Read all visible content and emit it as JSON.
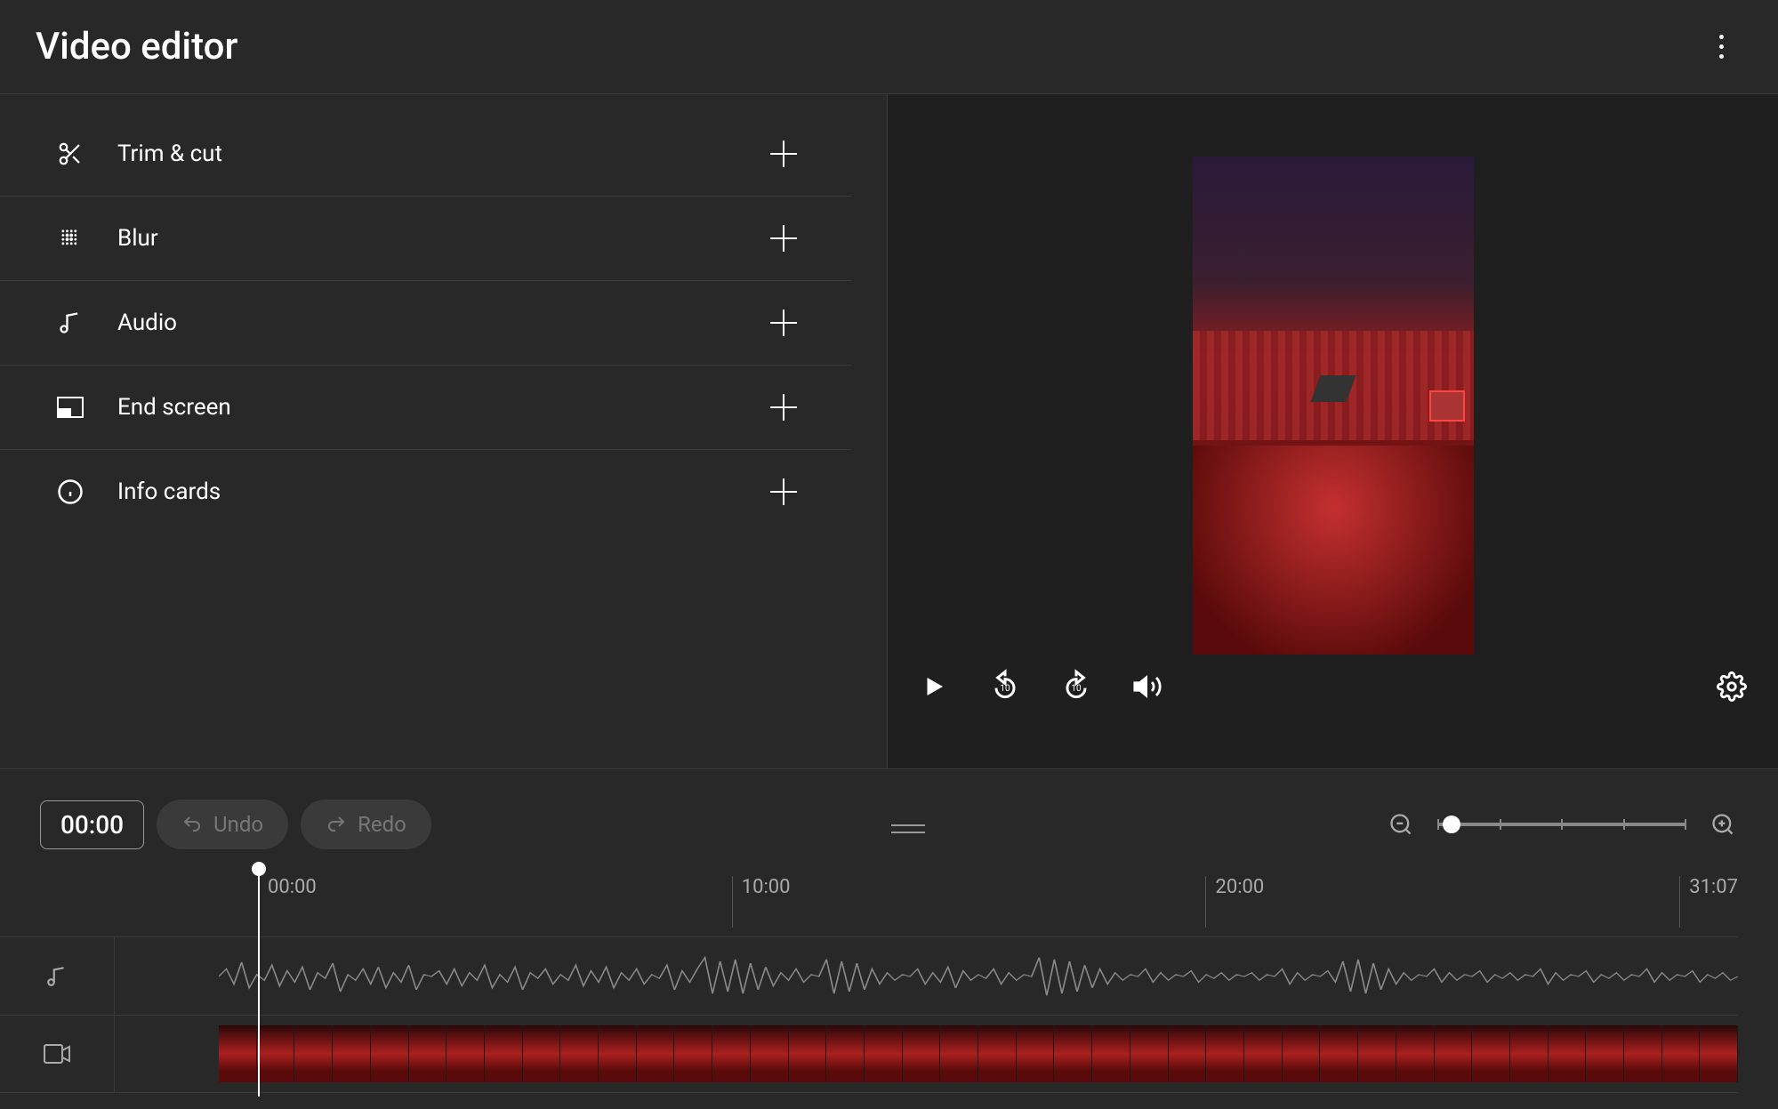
{
  "header": {
    "title": "Video editor"
  },
  "tools": {
    "trim_cut": "Trim & cut",
    "blur": "Blur",
    "audio": "Audio",
    "end_screen": "End screen",
    "info_cards": "Info cards"
  },
  "preview": {
    "replay_amount": "10",
    "forward_amount": "10"
  },
  "timeline": {
    "current_time": "00:00",
    "undo_label": "Undo",
    "redo_label": "Redo",
    "ticks": {
      "t0": "00:00",
      "t1": "10:00",
      "t2": "20:00",
      "t3": "31:07"
    },
    "duration": "31:07",
    "zoom_level_percent": 3
  },
  "colors": {
    "bg": "#282828",
    "preview_bg": "#1f1f1f",
    "divider": "#3a3a3a",
    "disabled_text": "#777"
  }
}
